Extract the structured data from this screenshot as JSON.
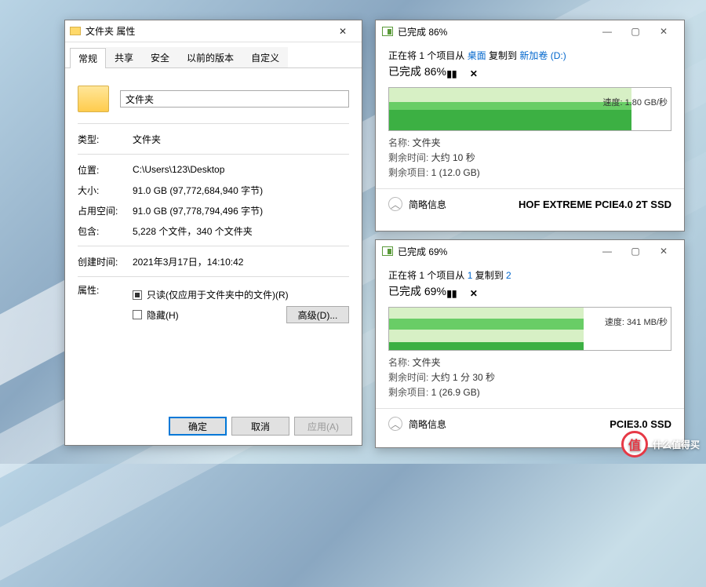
{
  "props": {
    "title": "文件夹 属性",
    "tabs": [
      "常规",
      "共享",
      "安全",
      "以前的版本",
      "自定义"
    ],
    "name_value": "文件夹",
    "rows": {
      "type_label": "类型:",
      "type_value": "文件夹",
      "loc_label": "位置:",
      "loc_value": "C:\\Users\\123\\Desktop",
      "size_label": "大小:",
      "size_value": "91.0 GB (97,772,684,940 字节)",
      "disk_label": "占用空间:",
      "disk_value": "91.0 GB (97,778,794,496 字节)",
      "contains_label": "包含:",
      "contains_value": "5,228 个文件，340 个文件夹",
      "created_label": "创建时间:",
      "created_value": "2021年3月17日，14:10:42",
      "attr_label": "属性:"
    },
    "readonly_text": "只读(仅应用于文件夹中的文件)(R)",
    "hidden_text": "隐藏(H)",
    "advanced_btn": "高级(D)...",
    "ok": "确定",
    "cancel": "取消",
    "apply": "应用(A)"
  },
  "copy1": {
    "title": "已完成 86%",
    "src_prefix": "正在将 1 个项目从 ",
    "src_link1": "桌面",
    "src_mid": " 复制到 ",
    "src_link2": "新加卷 (D:)",
    "pct_line": "已完成 86%",
    "speed": "速度: 1.80 GB/秒",
    "graph": {
      "pct": 86,
      "barpct": 86
    },
    "name_label": "名称: ",
    "name_value": "文件夹",
    "time_label": "剩余时间: ",
    "time_value": "大约 10 秒",
    "items_label": "剩余项目: ",
    "items_value": "1 (12.0 GB)",
    "brief": "简略信息",
    "annotation": "HOF EXTREME PCIE4.0 2T SSD"
  },
  "copy2": {
    "title": "已完成 69%",
    "src_prefix": "正在将 1 个项目从 ",
    "src_link1": "1",
    "src_mid": " 复制到 ",
    "src_link2": "2",
    "pct_line": "已完成 69%",
    "speed": "速度: 341 MB/秒",
    "graph": {
      "pct": 69,
      "barpct": 69
    },
    "name_label": "名称: ",
    "name_value": "文件夹",
    "time_label": "剩余时间: ",
    "time_value": "大约 1 分 30 秒",
    "items_label": "剩余项目: ",
    "items_value": "1 (26.9 GB)",
    "brief": "简略信息",
    "annotation": "PCIE3.0 SSD"
  },
  "watermark": {
    "badge": "值",
    "text": "什么值得买"
  }
}
